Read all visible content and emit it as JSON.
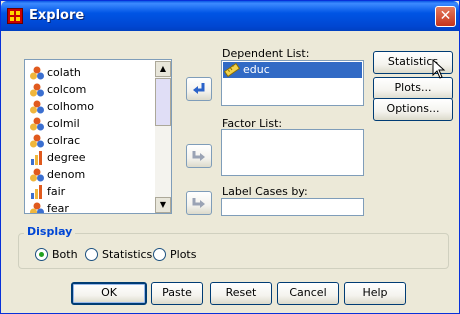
{
  "window": {
    "title": "Explore",
    "close_glyph": "✕"
  },
  "variables": {
    "items": [
      {
        "label": "colath",
        "icon": "nominal-variable-icon"
      },
      {
        "label": "colcom",
        "icon": "nominal-variable-icon"
      },
      {
        "label": "colhomo",
        "icon": "nominal-variable-icon"
      },
      {
        "label": "colmil",
        "icon": "nominal-variable-icon"
      },
      {
        "label": "colrac",
        "icon": "nominal-variable-icon"
      },
      {
        "label": "degree",
        "icon": "ordinal-variable-icon"
      },
      {
        "label": "denom",
        "icon": "nominal-variable-icon"
      },
      {
        "label": "fair",
        "icon": "ordinal-variable-icon"
      },
      {
        "label": "fear",
        "icon": "nominal-variable-icon"
      }
    ]
  },
  "dependent": {
    "label": "Dependent List:",
    "items": [
      {
        "label": "educ",
        "icon": "scale-variable-icon"
      }
    ]
  },
  "factor": {
    "label": "Factor List:"
  },
  "label_cases": {
    "label": "Label Cases by:",
    "value": ""
  },
  "side_buttons": {
    "statistics": "Statistics",
    "plots": "Plots...",
    "options": "Options..."
  },
  "display": {
    "title": "Display",
    "options": [
      {
        "label": "Both",
        "selected": true
      },
      {
        "label": "Statistics",
        "selected": false
      },
      {
        "label": "Plots",
        "selected": false
      }
    ]
  },
  "footer": {
    "ok": "OK",
    "paste": "Paste",
    "reset": "Reset",
    "cancel": "Cancel",
    "help": "Help"
  },
  "colors": {
    "title_bar": "#0055e5",
    "window_bg": "#ece9d8",
    "selection": "#316ac5",
    "group_title": "#0046d5"
  }
}
